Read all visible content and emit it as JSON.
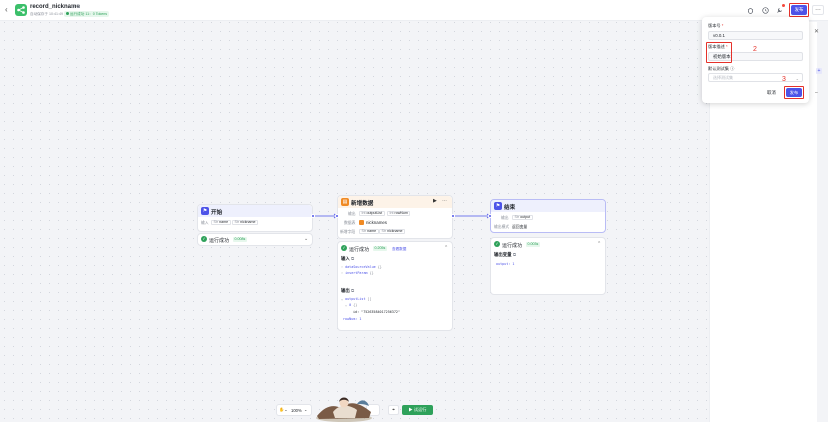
{
  "header": {
    "back_glyph": "‹",
    "title": "record_nickname",
    "title_icons": "⊙ ⧉",
    "auto_save": "自动保存于 10:41:49",
    "test_badge": "运行成功 11：0 Tokens",
    "publish_label": "发布",
    "more_glyph": "…",
    "icon_names": [
      "bug-icon",
      "history-icon",
      "tools-icon"
    ]
  },
  "popup": {
    "version_label": "版本号",
    "version_value": "v0.0.1",
    "desc_label": "版本描述",
    "desc_value": "初始版本",
    "test_set_label": "默认测试集",
    "test_set_placeholder": "选择测试集",
    "cancel_label": "取消",
    "publish_label": "发布"
  },
  "annotations": [
    "1",
    "2",
    "3"
  ],
  "nodes": {
    "start": {
      "title": "开始",
      "input_key": "输入",
      "params": [
        {
          "type": "Str",
          "name": "name"
        },
        {
          "type": "Str",
          "name": "nickname"
        }
      ],
      "status": "运行成功",
      "time": "0.008s"
    },
    "add": {
      "title": "新增数据",
      "output_key": "输出",
      "outputs": [
        {
          "type": "Int",
          "name": "outputList"
        },
        {
          "type": "Int",
          "name": "rowNum"
        }
      ],
      "table_key": "数据表",
      "table_name": "nicknames",
      "insert_key": "新增字段",
      "fields": [
        {
          "type": "Str",
          "name": "name"
        },
        {
          "type": "Str",
          "name": "nickname"
        }
      ],
      "status": "运行成功",
      "time": "0.205s",
      "view_data": "查看数据",
      "input_title": "输入",
      "input_lines": [
        "dataSourceValue",
        "insertParam"
      ],
      "output_title": "输出",
      "output_lines": [
        "outputList",
        "0",
        "id: \"75263584017256372\"",
        "rowNum: 1"
      ]
    },
    "end": {
      "title": "结束",
      "output_key": "输出",
      "output_param": "output",
      "answer_key": "输出模式",
      "answer_value": "返回变量",
      "status": "运行成功",
      "time": "0.003s",
      "result_title": "输出变量",
      "result_line": "output: 1"
    }
  },
  "toolbar": {
    "zoom": "100%",
    "run_label": "试运行"
  },
  "colors": {
    "brand": "#4d53e8",
    "success": "#2ea15a",
    "annotation": "#e5312a"
  }
}
